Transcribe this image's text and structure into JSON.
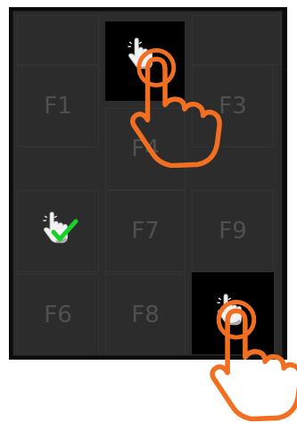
{
  "keys": [
    {
      "id": "F1",
      "label": "F1"
    },
    {
      "id": "F3",
      "label": "F3"
    },
    {
      "id": "F4",
      "label": "F4"
    },
    {
      "id": "F7",
      "label": "F7"
    },
    {
      "id": "F9",
      "label": "F9"
    },
    {
      "id": "F6",
      "label": "F6"
    },
    {
      "id": "F8",
      "label": "F8"
    }
  ],
  "icons": {
    "tap_top": "hand-tap-icon",
    "tap_confirmed": "hand-tap-check-icon",
    "tap_bottom": "hand-tap-icon",
    "gesture_top": "pointing-hand-outline-icon",
    "gesture_bottom": "pointing-hand-outline-icon"
  },
  "colors": {
    "gesture": "#f26f21",
    "check": "#19d02a"
  }
}
